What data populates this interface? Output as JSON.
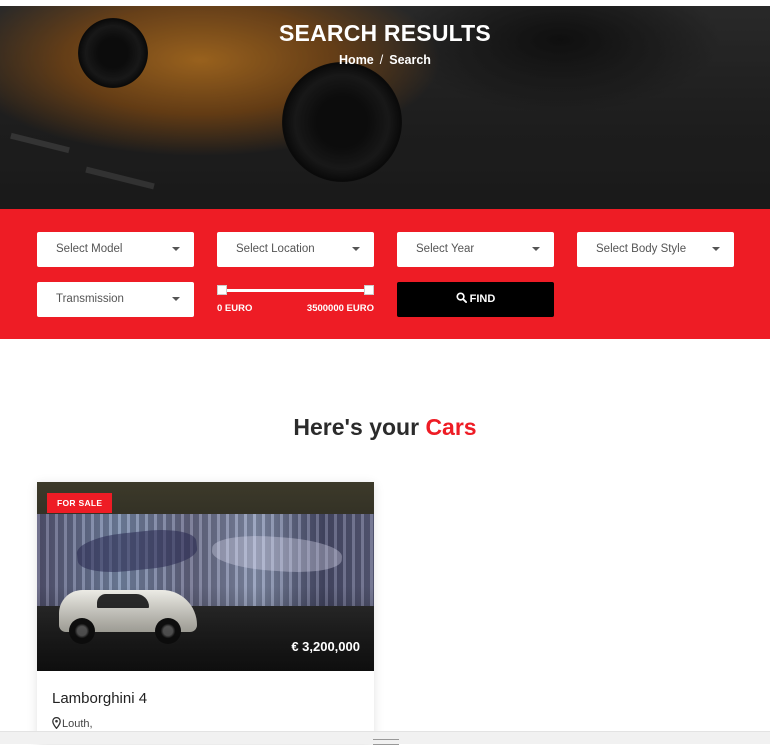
{
  "hero": {
    "title": "SEARCH RESULTS",
    "breadcrumb": {
      "home": "Home",
      "separator": "/",
      "current": "Search"
    }
  },
  "filters": {
    "model": "Select Model",
    "location": "Select Location",
    "year": "Select Year",
    "body_style": "Select Body Style",
    "transmission": "Transmission",
    "price_range": {
      "min_label": "0 EURO",
      "max_label": "3500000 EURO",
      "min": 0,
      "max": 3500000
    },
    "find_label": "FIND"
  },
  "results": {
    "heading_prefix": "Here's your",
    "heading_accent": "Cars"
  },
  "cars": [
    {
      "badge": "FOR SALE",
      "price": "€ 3,200,000",
      "title": "Lamborghini 4",
      "location": "Louth,"
    }
  ],
  "colors": {
    "accent": "#ee1c25",
    "button": "#000000"
  },
  "icons": {
    "find": "search-icon",
    "location": "map-marker-icon"
  }
}
